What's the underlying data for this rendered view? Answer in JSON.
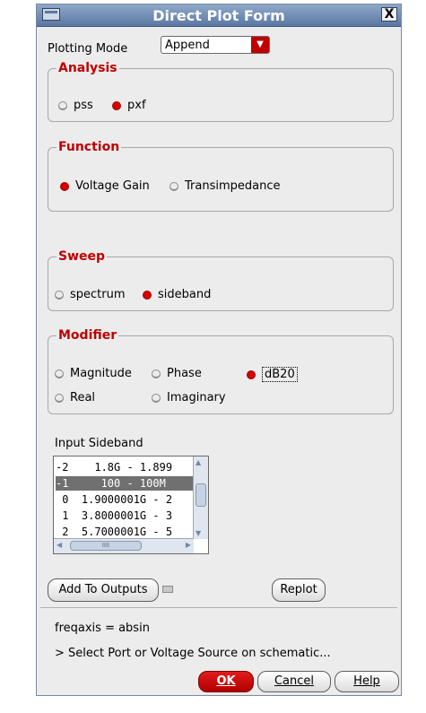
{
  "window": {
    "title": "Direct Plot Form",
    "close_symbol": "X"
  },
  "plotting_mode": {
    "label": "Plotting Mode",
    "value": "Append"
  },
  "analysis": {
    "title": "Analysis",
    "options": [
      "pss",
      "pxf"
    ],
    "selected": "pxf"
  },
  "function": {
    "title": "Function",
    "options": [
      "Voltage Gain",
      "Transimpedance"
    ],
    "selected": "Voltage Gain"
  },
  "sweep": {
    "title": "Sweep",
    "options": [
      "spectrum",
      "sideband"
    ],
    "selected": "sideband"
  },
  "modifier": {
    "title": "Modifier",
    "options": [
      "Magnitude",
      "Phase",
      "dB20",
      "Real",
      "Imaginary"
    ],
    "selected": "dB20"
  },
  "sideband": {
    "label": "Input Sideband",
    "rows": [
      "-2    1.8G - 1.899",
      "-1     100 - 100M",
      " 0  1.9000001G - 2",
      " 1  3.8000001G - 3",
      " 2  5.7000001G - 5"
    ],
    "selected_index": 1,
    "scroll_grip": "IIII"
  },
  "buttons": {
    "add_to_outputs": "Add To Outputs",
    "replot": "Replot",
    "ok": "OK",
    "cancel": "Cancel",
    "help": "Help"
  },
  "status": {
    "freqaxis": "freqaxis = absin",
    "prompt": "> Select Port or Voltage Source on schematic..."
  }
}
